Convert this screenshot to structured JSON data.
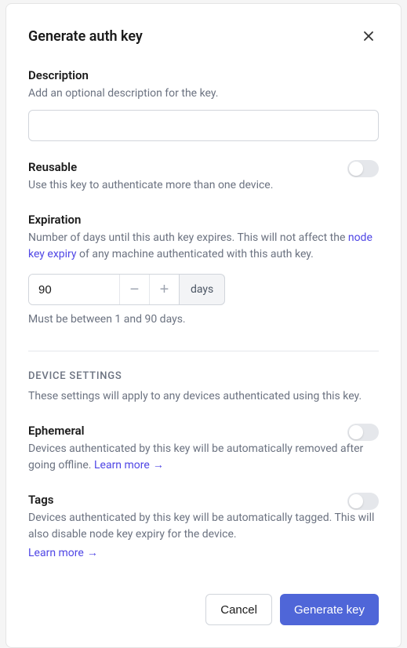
{
  "modal": {
    "title": "Generate auth key"
  },
  "description": {
    "label": "Description",
    "help": "Add an optional description for the key.",
    "value": ""
  },
  "reusable": {
    "label": "Reusable",
    "help": "Use this key to authenticate more than one device."
  },
  "expiration": {
    "label": "Expiration",
    "help_pre": "Number of days until this auth key expires. This will not affect the ",
    "help_link": "node key expiry",
    "help_post": " of any machine authenticated with this auth key.",
    "value": "90",
    "unit": "days",
    "hint": "Must be between 1 and 90 days."
  },
  "device_settings": {
    "heading": "DEVICE SETTINGS",
    "help": "These settings will apply to any devices authenticated using this key."
  },
  "ephemeral": {
    "label": "Ephemeral",
    "help": "Devices authenticated by this key will be automatically removed after going offline. ",
    "learn_more": "Learn more"
  },
  "tags": {
    "label": "Tags",
    "help": "Devices authenticated by this key will be automatically tagged. This will also disable node key expiry for the device.",
    "learn_more": "Learn more"
  },
  "footer": {
    "cancel": "Cancel",
    "submit": "Generate key"
  }
}
